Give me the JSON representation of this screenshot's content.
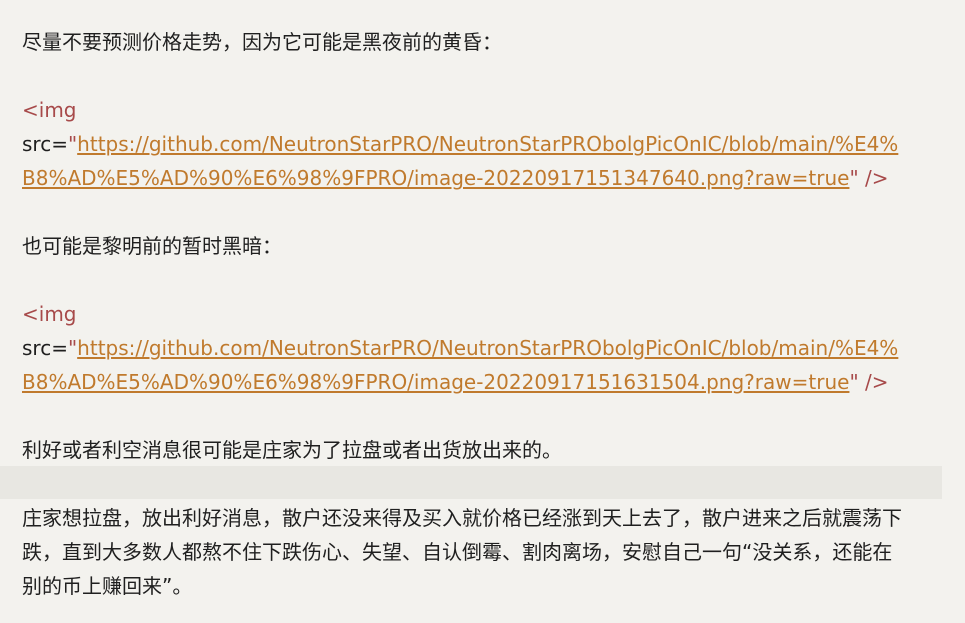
{
  "paragraphs": {
    "p1": "尽量不要预测价格走势，因为它可能是黑夜前的黄昏：",
    "p2": "也可能是黎明前的暂时黑暗：",
    "p3": "利好或者利空消息很可能是庄家为了拉盘或者出货放出来的。",
    "p4": "庄家想拉盘，放出利好消息，散户还没来得及买入就价格已经涨到天上去了，散户进来之后就震荡下跌，直到大多数人都熬不住下跌伤心、失望、自认倒霉、割肉离场，安慰自己一句“没关系，还能在别的币上赚回来”。"
  },
  "img1": {
    "tag_open": "<img",
    "src_attr": "src=",
    "quote": "\"",
    "url_line1": "https://github.com/NeutronStarPRO/NeutronStarPRObolgPicOnIC/blob/main/%E4%",
    "url_line2": "B8%AD%E5%AD%90%E6%98%9FPRO/image-20220917151347640.png?raw=true",
    "close": "\"  />"
  },
  "img2": {
    "tag_open": "<img",
    "src_attr": "src=",
    "quote": "\"",
    "url_line1": "https://github.com/NeutronStarPRO/NeutronStarPRObolgPicOnIC/blob/main/%E4%",
    "url_line2": "B8%AD%E5%AD%90%E6%98%9FPRO/image-20220917151631504.png?raw=true",
    "close": "\"  />"
  },
  "colors": {
    "background": "#f3f2ee",
    "text": "#1f1f1f",
    "tag": "#a74a4a",
    "link": "#c07a2d",
    "band": "#e8e7e2"
  }
}
